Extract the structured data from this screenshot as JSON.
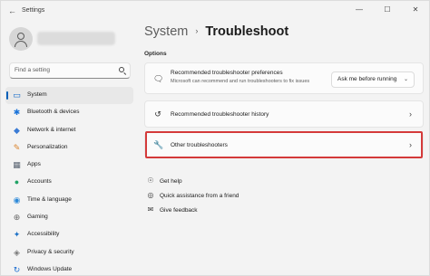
{
  "window": {
    "title": "Settings",
    "minimize_glyph": "—",
    "maximize_glyph": "☐",
    "close_glyph": "✕"
  },
  "sidebar": {
    "search_placeholder": "Find a setting",
    "items": [
      {
        "label": "System",
        "icon": "monitor-icon",
        "glyph": "▭",
        "color": "#0a64c8",
        "active": true
      },
      {
        "label": "Bluetooth & devices",
        "icon": "bluetooth-icon",
        "glyph": "✱",
        "color": "#1a73d9"
      },
      {
        "label": "Network & internet",
        "icon": "wifi-icon",
        "glyph": "◆",
        "color": "#3a7bd5"
      },
      {
        "label": "Personalization",
        "icon": "brush-icon",
        "glyph": "✎",
        "color": "#d9822b"
      },
      {
        "label": "Apps",
        "icon": "apps-icon",
        "glyph": "▦",
        "color": "#5a6472"
      },
      {
        "label": "Accounts",
        "icon": "person-icon",
        "glyph": "●",
        "color": "#21a366"
      },
      {
        "label": "Time & language",
        "icon": "globe-clock-icon",
        "glyph": "◉",
        "color": "#2b88d8"
      },
      {
        "label": "Gaming",
        "icon": "gamepad-icon",
        "glyph": "⊕",
        "color": "#6b6b6b"
      },
      {
        "label": "Accessibility",
        "icon": "accessibility-icon",
        "glyph": "✦",
        "color": "#1e72c7"
      },
      {
        "label": "Privacy & security",
        "icon": "shield-icon",
        "glyph": "◈",
        "color": "#7a7a7a"
      },
      {
        "label": "Windows Update",
        "icon": "update-icon",
        "glyph": "↻",
        "color": "#1f6fd1"
      }
    ]
  },
  "breadcrumb": {
    "root": "System",
    "separator": "›",
    "current": "Troubleshoot"
  },
  "section_label": "Options",
  "cards": {
    "preferences": {
      "title": "Recommended troubleshooter preferences",
      "description": "Microsoft can recommend and run troubleshooters to fix issues",
      "dropdown_value": "Ask me before running",
      "dropdown_glyph": "⌄",
      "icon_glyph": "🗨"
    },
    "history": {
      "title": "Recommended troubleshooter history",
      "chevron": "›",
      "icon_glyph": "↺"
    },
    "other": {
      "title": "Other troubleshooters",
      "chevron": "›",
      "icon_glyph": "🔧"
    }
  },
  "help_links": [
    {
      "label": "Get help",
      "icon": "help-icon",
      "glyph": "☉"
    },
    {
      "label": "Quick assistance from a friend",
      "icon": "remote-assist-icon",
      "glyph": "◎"
    },
    {
      "label": "Give feedback",
      "icon": "feedback-icon",
      "glyph": "✉"
    }
  ],
  "colors": {
    "accent": "#005fb8",
    "highlight_border": "#d43a3a"
  }
}
